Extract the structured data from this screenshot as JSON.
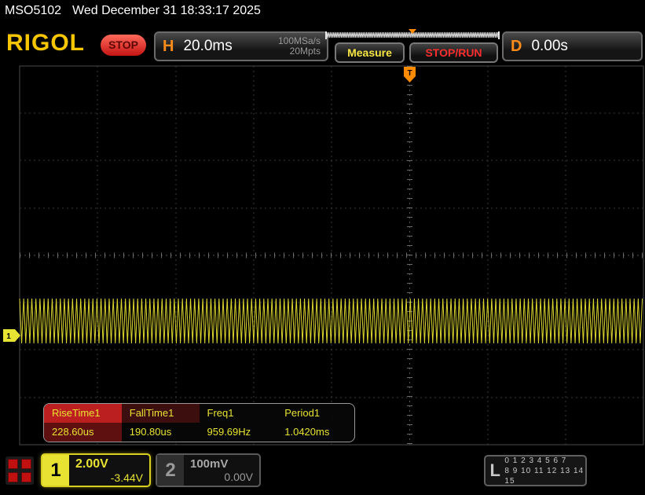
{
  "window": {
    "model": "MSO5102",
    "datetime": "Wed December 31 18:33:17 2025"
  },
  "header": {
    "logo": "RIGOL",
    "run_state": "STOP",
    "horizontal": {
      "label": "H",
      "timebase": "20.0ms",
      "sample_rate": "100MSa/s",
      "mem_depth": "20Mpts"
    },
    "measure_button": "Measure",
    "stoprun_button": "STOP/RUN",
    "delay": {
      "label": "D",
      "value": "0.00s"
    }
  },
  "markers": {
    "trigger": "T",
    "ch1": "1"
  },
  "measurements": [
    {
      "name": "RiseTime1",
      "value": "228.60us"
    },
    {
      "name": "FallTime1",
      "value": "190.80us"
    },
    {
      "name": "Freq1",
      "value": "959.69Hz"
    },
    {
      "name": "Period1",
      "value": "1.0420ms"
    }
  ],
  "channels": {
    "ch1": {
      "number": "1",
      "scale": "2.00V",
      "offset": "-3.44V"
    },
    "ch2": {
      "number": "2",
      "scale": "100mV",
      "offset": "0.00V"
    }
  },
  "digital": {
    "label": "L",
    "row1": "0 1 2 3 4 5 6 7",
    "row2": "8 9 10 11 12 13 14 15"
  },
  "icons": {
    "app_menu": "red-grid-squares",
    "trigger_marker": "orange-T-flag",
    "ch1_ground_marker": "yellow-arrow-1"
  },
  "colors": {
    "ch1_trace": "#e8e332",
    "trigger_orange": "#ff8c00",
    "stop_red": "#ff2d2d",
    "logo_gold": "#f7c600"
  }
}
